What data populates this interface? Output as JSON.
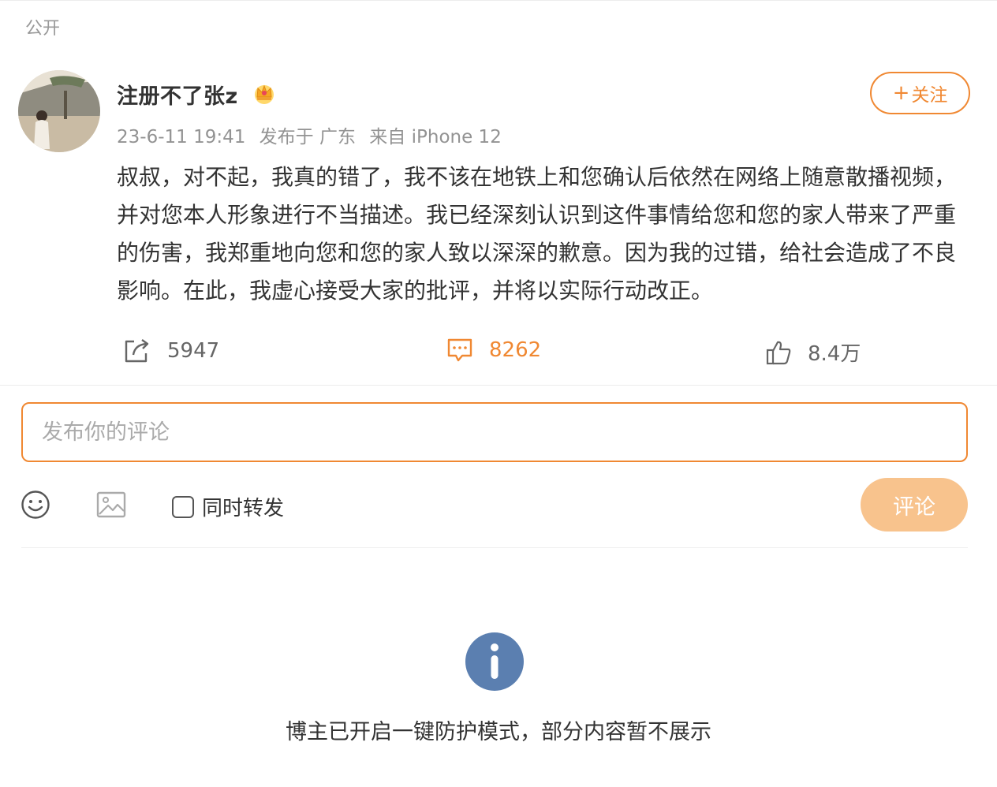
{
  "visibility": "公开",
  "post": {
    "author": "注册不了张z",
    "badge_icon": "crown-icon",
    "follow_label": "关注",
    "timestamp": "23-6-11 19:41",
    "location": "发布于 广东",
    "source": "来自 iPhone 12",
    "content": "叔叔，对不起，我真的错了，我不该在地铁上和您确认后依然在网络上随意散播视频，并对您本人形象进行不当描述。我已经深刻认识到这件事情给您和您的家人带来了严重的伤害，我郑重地向您和您的家人致以深深的歉意。因为我的过错，给社会造成了不良影响。在此，我虚心接受大家的批评，并将以实际行动改正。"
  },
  "actions": {
    "repost_count": "5947",
    "comment_count": "8262",
    "like_count": "8.4万"
  },
  "comment_box": {
    "placeholder": "发布你的评论",
    "repost_label": "同时转发",
    "submit_label": "评论"
  },
  "notice": {
    "text": "博主已开启一键防护模式，部分内容暂不展示"
  },
  "colors": {
    "accent": "#f08832",
    "submit_disabled": "#f8c38d",
    "info": "#5b7fb0"
  }
}
